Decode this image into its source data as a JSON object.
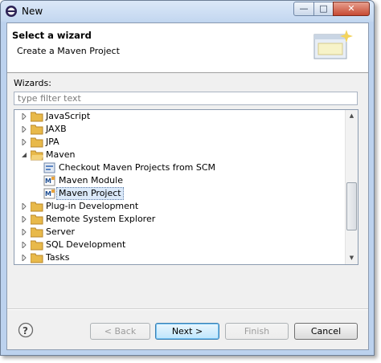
{
  "window": {
    "title": "New",
    "close_glyph": "✕",
    "minimize_glyph": "—",
    "maximize_glyph": "□"
  },
  "header": {
    "title": "Select a wizard",
    "description": "Create a Maven Project"
  },
  "wizards_label": "Wizards:",
  "filter": {
    "placeholder": "type filter text",
    "value": ""
  },
  "tree": {
    "items": [
      {
        "label": "JavaScript",
        "icon": "folder-icon",
        "level": 0,
        "expander": "collapsed"
      },
      {
        "label": "JAXB",
        "icon": "folder-icon",
        "level": 0,
        "expander": "collapsed"
      },
      {
        "label": "JPA",
        "icon": "folder-icon",
        "level": 0,
        "expander": "collapsed"
      },
      {
        "label": "Maven",
        "icon": "folder-icon",
        "level": 0,
        "expander": "expanded"
      },
      {
        "label": "Checkout Maven Projects from SCM",
        "icon": "scm-checkout-icon",
        "level": 1,
        "expander": "none"
      },
      {
        "label": "Maven Module",
        "icon": "maven-module-icon",
        "level": 1,
        "expander": "none"
      },
      {
        "label": "Maven Project",
        "icon": "maven-project-icon",
        "level": 1,
        "expander": "none",
        "selected": true
      },
      {
        "label": "Plug-in Development",
        "icon": "folder-icon",
        "level": 0,
        "expander": "collapsed"
      },
      {
        "label": "Remote System Explorer",
        "icon": "folder-icon",
        "level": 0,
        "expander": "collapsed"
      },
      {
        "label": "Server",
        "icon": "folder-icon",
        "level": 0,
        "expander": "collapsed"
      },
      {
        "label": "SQL Development",
        "icon": "folder-icon",
        "level": 0,
        "expander": "collapsed"
      },
      {
        "label": "Tasks",
        "icon": "folder-icon",
        "level": 0,
        "expander": "collapsed"
      }
    ]
  },
  "buttons": {
    "back": "< Back",
    "next": "Next >",
    "finish": "Finish",
    "cancel": "Cancel"
  },
  "help_glyph": "?",
  "colors": {
    "selection": "#dbe9f9",
    "folder": "#e8b94a",
    "default_button": "#bee6fd"
  }
}
